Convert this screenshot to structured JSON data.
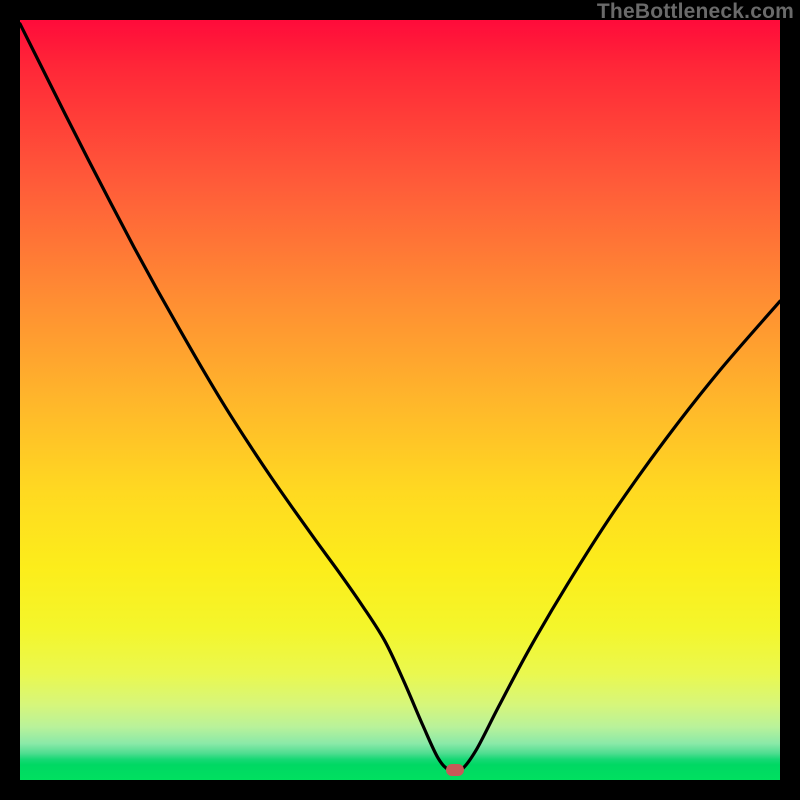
{
  "watermark": "TheBottleneck.com",
  "colors": {
    "frame": "#000000",
    "curve": "#000000",
    "marker": "#c65a58"
  },
  "chart_data": {
    "type": "line",
    "title": "",
    "xlabel": "",
    "ylabel": "",
    "xlim": [
      0,
      100
    ],
    "ylim": [
      0,
      100
    ],
    "grid": false,
    "legend": false,
    "series": [
      {
        "name": "bottleneck_curve",
        "x": [
          0,
          3,
          6,
          9,
          12,
          15,
          18,
          21,
          24,
          27,
          30,
          33,
          36,
          39,
          42,
          45,
          48,
          50.5,
          53,
          55,
          56.5,
          58,
          60,
          63,
          67,
          72,
          78,
          85,
          92,
          100
        ],
        "y": [
          99.5,
          93.5,
          87.5,
          81.6,
          75.8,
          70.1,
          64.6,
          59.3,
          54.1,
          49.1,
          44.4,
          39.9,
          35.6,
          31.4,
          27.3,
          23.0,
          18.3,
          13.0,
          7.2,
          2.9,
          1.3,
          1.3,
          3.9,
          9.7,
          17.2,
          25.7,
          35.1,
          44.9,
          53.8,
          63.0
        ]
      }
    ],
    "annotations": [
      {
        "name": "optimal_marker",
        "x": 57.3,
        "y": 1.3
      }
    ],
    "background_gradient": {
      "orientation": "vertical",
      "stops": [
        {
          "pos": 0.0,
          "color": "#ff0b3a"
        },
        {
          "pos": 0.5,
          "color": "#ffb62b"
        },
        {
          "pos": 0.8,
          "color": "#f4f62b"
        },
        {
          "pos": 0.95,
          "color": "#8ae9a8"
        },
        {
          "pos": 1.0,
          "color": "#00e060"
        }
      ]
    }
  }
}
